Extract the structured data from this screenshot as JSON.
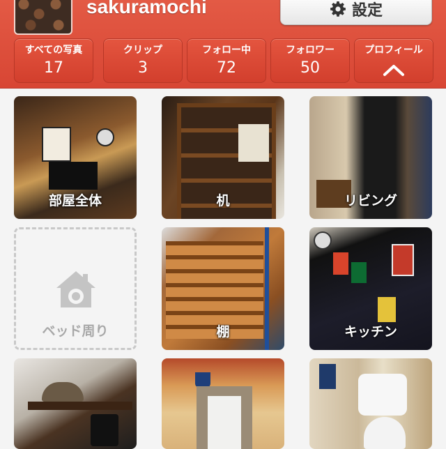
{
  "profile": {
    "username": "sakuramochi",
    "settings_label": "設定"
  },
  "tabs": [
    {
      "label": "すべての写真",
      "count": "17"
    },
    {
      "label": "クリップ",
      "count": "3"
    },
    {
      "label": "フォロー中",
      "count": "72"
    },
    {
      "label": "フォロワー",
      "count": "50"
    },
    {
      "label": "プロフィール",
      "icon": "chevron-up-icon"
    }
  ],
  "albums": [
    {
      "caption": "部屋全体"
    },
    {
      "caption": "机"
    },
    {
      "caption": "リビング"
    },
    {
      "caption": "ベッド周り",
      "empty": true,
      "icon": "house-camera-icon"
    },
    {
      "caption": "棚"
    },
    {
      "caption": "キッチン"
    },
    {
      "caption": ""
    },
    {
      "caption": ""
    },
    {
      "caption": ""
    }
  ],
  "colors": {
    "header": "#d84634",
    "tab": "#d8442f",
    "placeholder": "#c8c8c8"
  }
}
